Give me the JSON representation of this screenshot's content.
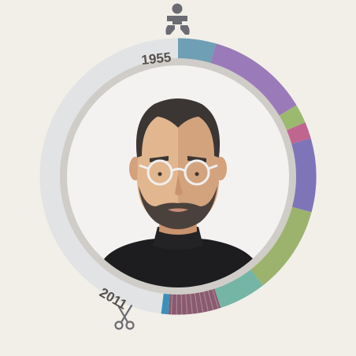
{
  "timeline": {
    "start_year": "1955",
    "end_year": "2011",
    "birth_icon": "baby-icon",
    "death_icon": "scissors-icon"
  },
  "portrait": {
    "subject_icon": "bald-man-with-round-glasses-and-beard-portrait"
  },
  "ring_segments": [
    {
      "color": "#6f9fb4",
      "span_deg": 16
    },
    {
      "color": "#9b7ab9",
      "span_deg": 43
    },
    {
      "color": "#9cba6f",
      "span_deg": 8
    },
    {
      "color": "#c0658f",
      "span_deg": 7
    },
    {
      "color": "#7e75b9",
      "span_deg": 31
    },
    {
      "color": "#9cb36d",
      "span_deg": 37
    },
    {
      "color": "#75b5a6",
      "span_deg": 20
    },
    {
      "color": "#8a5a6e",
      "span_deg": 22
    },
    {
      "color": "#3c8fb8",
      "span_deg": 3
    }
  ],
  "colors": {
    "background": "#f2efe9",
    "ring_track": "#e2e3e5",
    "inner_border": "#d0cdc8",
    "inner_face": "#f3f2f1",
    "icon": "#6b6b73"
  }
}
